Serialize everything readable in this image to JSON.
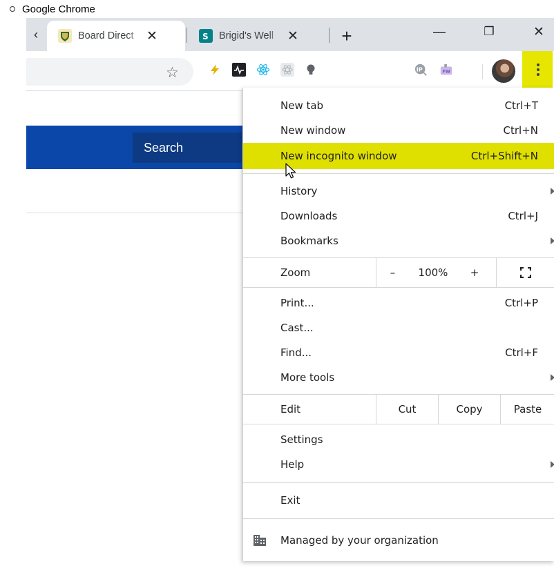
{
  "caption": "Google Chrome",
  "tabs": [
    {
      "title": "Board Direct",
      "close": "✕"
    },
    {
      "title": "Brigid's Well",
      "close": "✕"
    }
  ],
  "tabstrip": {
    "scroll_left": "‹",
    "new_tab": "+",
    "minimize": "—",
    "restore": "❐",
    "close": "✕"
  },
  "toolbar": {
    "bookmark_icon": "star-outline-icon"
  },
  "page": {
    "search_label": "Search"
  },
  "menu": {
    "new_tab": {
      "label": "New tab",
      "shortcut": "Ctrl+T"
    },
    "new_window": {
      "label": "New window",
      "shortcut": "Ctrl+N"
    },
    "new_incognito": {
      "label": "New incognito window",
      "shortcut": "Ctrl+Shift+N"
    },
    "history": {
      "label": "History"
    },
    "downloads": {
      "label": "Downloads",
      "shortcut": "Ctrl+J"
    },
    "bookmarks": {
      "label": "Bookmarks"
    },
    "zoom": {
      "label": "Zoom",
      "minus": "–",
      "value": "100%",
      "plus": "+"
    },
    "print": {
      "label": "Print...",
      "shortcut": "Ctrl+P"
    },
    "cast": {
      "label": "Cast..."
    },
    "find": {
      "label": "Find...",
      "shortcut": "Ctrl+F"
    },
    "more_tools": {
      "label": "More tools"
    },
    "edit": {
      "label": "Edit",
      "cut": "Cut",
      "copy": "Copy",
      "paste": "Paste"
    },
    "settings": {
      "label": "Settings"
    },
    "help": {
      "label": "Help"
    },
    "exit": {
      "label": "Exit"
    },
    "managed": {
      "label": "Managed by your organization"
    }
  },
  "colors": {
    "highlight": "#e0e000",
    "page_blue": "#0a47a9",
    "search_button": "#0d3a82"
  }
}
